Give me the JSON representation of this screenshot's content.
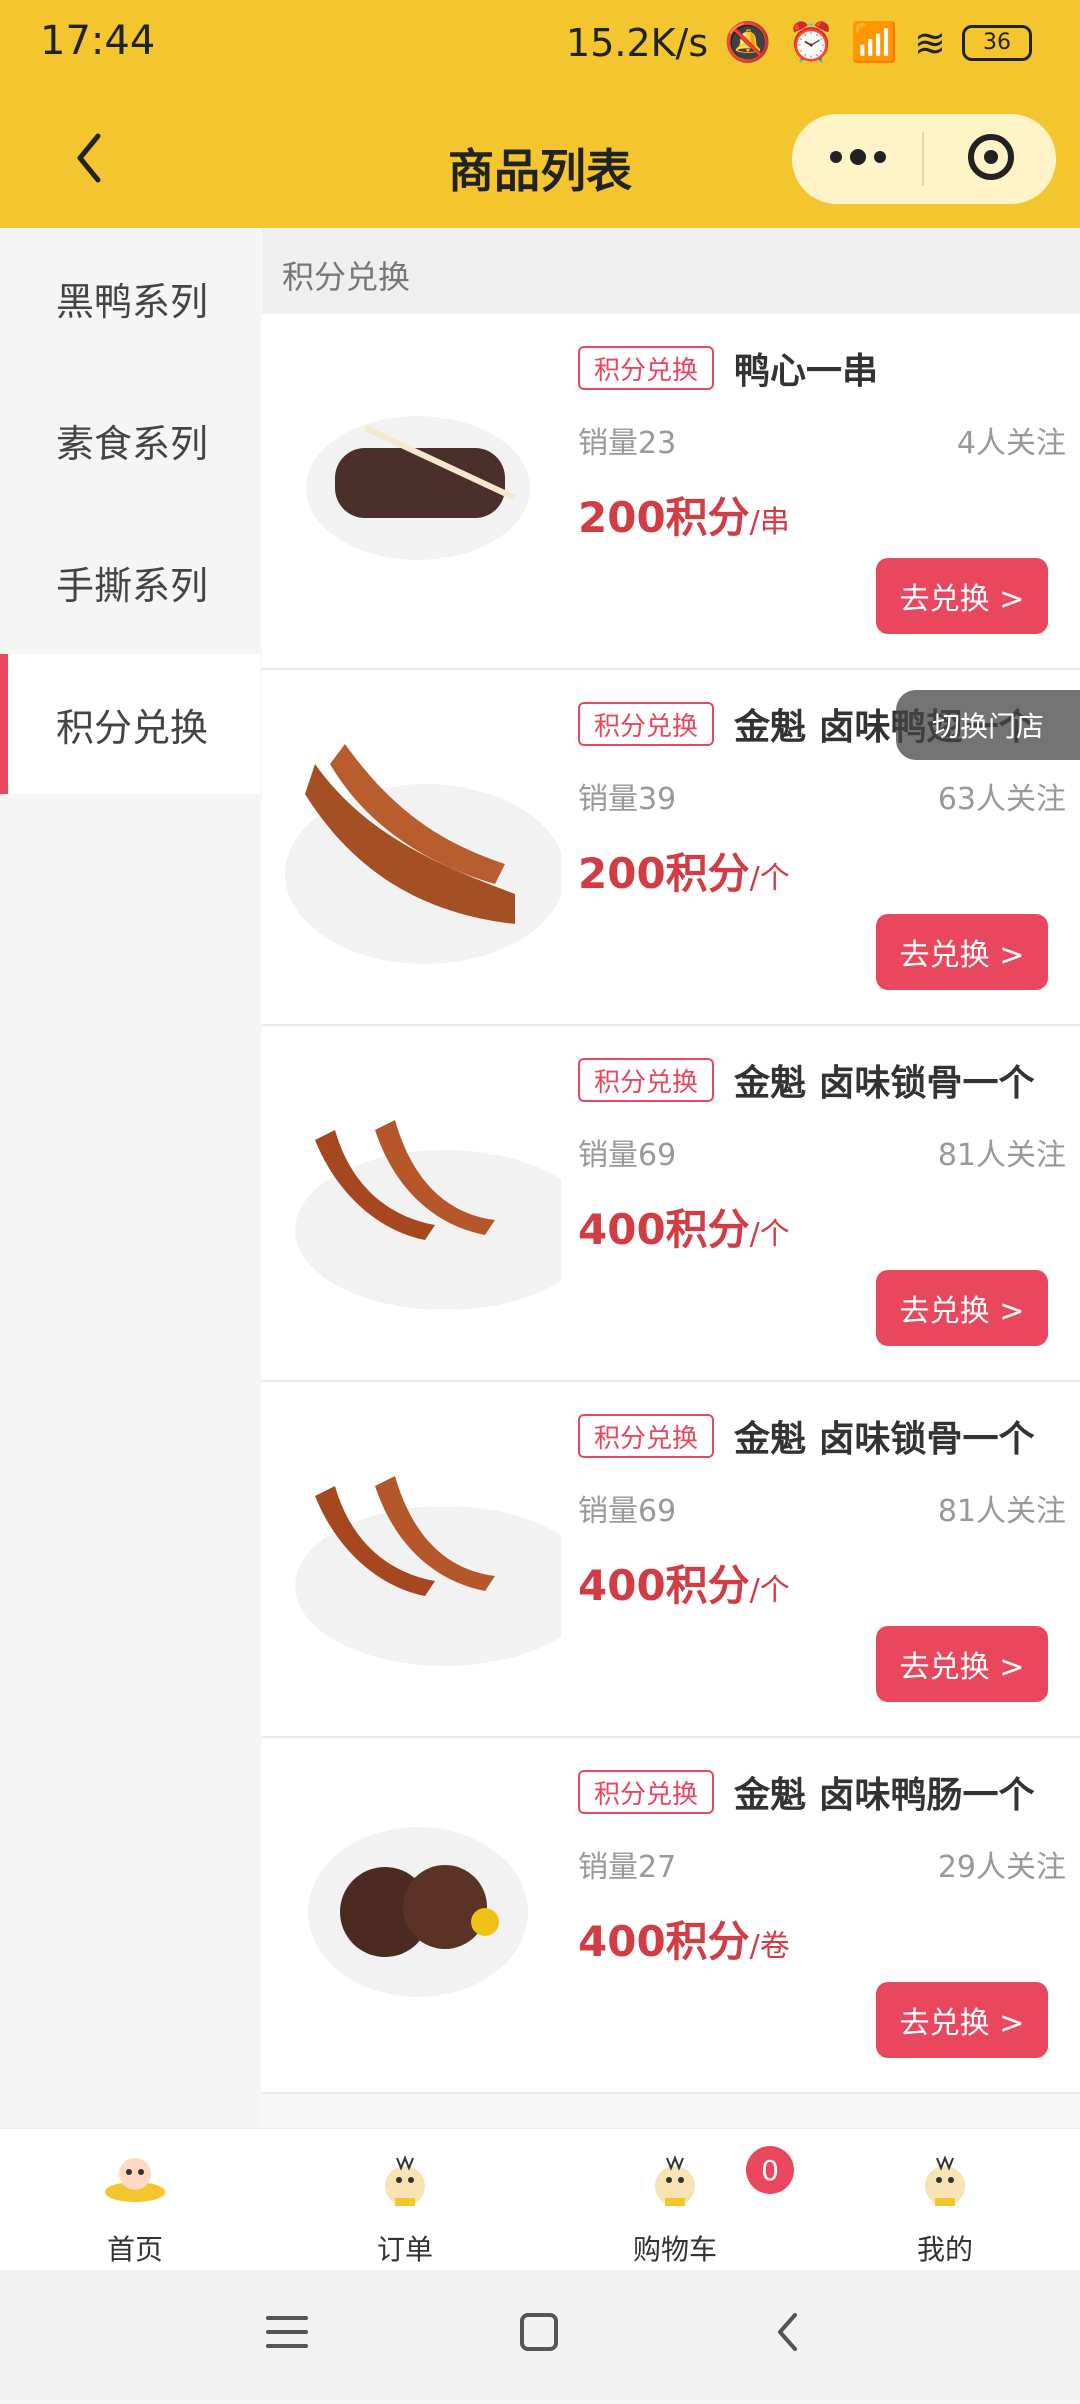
{
  "status": {
    "time": "17:44",
    "net_speed": "15.2K/s",
    "battery": "36"
  },
  "header": {
    "title": "商品列表"
  },
  "sidebar": {
    "items": [
      {
        "label": "黑鸭系列"
      },
      {
        "label": "素食系列"
      },
      {
        "label": "手撕系列"
      },
      {
        "label": "积分兑换"
      }
    ],
    "active": "积分兑换"
  },
  "section": {
    "title": "积分兑换"
  },
  "products": [
    {
      "tag": "积分兑换",
      "name": "鸭心一串",
      "sales": "销量23",
      "follow": "4人关注",
      "price": "200积分",
      "unit": "/串",
      "cta": "去兑换 >"
    },
    {
      "tag": "积分兑换",
      "name": "金魁 卤味鸭翅一个",
      "sales": "销量39",
      "follow": "63人关注",
      "price": "200积分",
      "unit": "/个",
      "cta": "去兑换 >"
    },
    {
      "tag": "积分兑换",
      "name": "金魁 卤味锁骨一个",
      "sales": "销量69",
      "follow": "81人关注",
      "price": "400积分",
      "unit": "/个",
      "cta": "去兑换 >"
    },
    {
      "tag": "积分兑换",
      "name": "金魁 卤味锁骨一个",
      "sales": "销量69",
      "follow": "81人关注",
      "price": "400积分",
      "unit": "/个",
      "cta": "去兑换 >"
    },
    {
      "tag": "积分兑换",
      "name": "金魁 卤味鸭肠一个",
      "sales": "销量27",
      "follow": "29人关注",
      "price": "400积分",
      "unit": "/卷",
      "cta": "去兑换 >"
    }
  ],
  "floating": {
    "switch_store": "切换门店"
  },
  "tabbar": {
    "items": [
      {
        "label": "首页"
      },
      {
        "label": "订单"
      },
      {
        "label": "购物车"
      },
      {
        "label": "我的"
      }
    ],
    "cart_badge": "0"
  },
  "colors": {
    "primary_yellow": "#f3c52f",
    "accent_red": "#e8475e",
    "price_red": "#d23c44"
  }
}
